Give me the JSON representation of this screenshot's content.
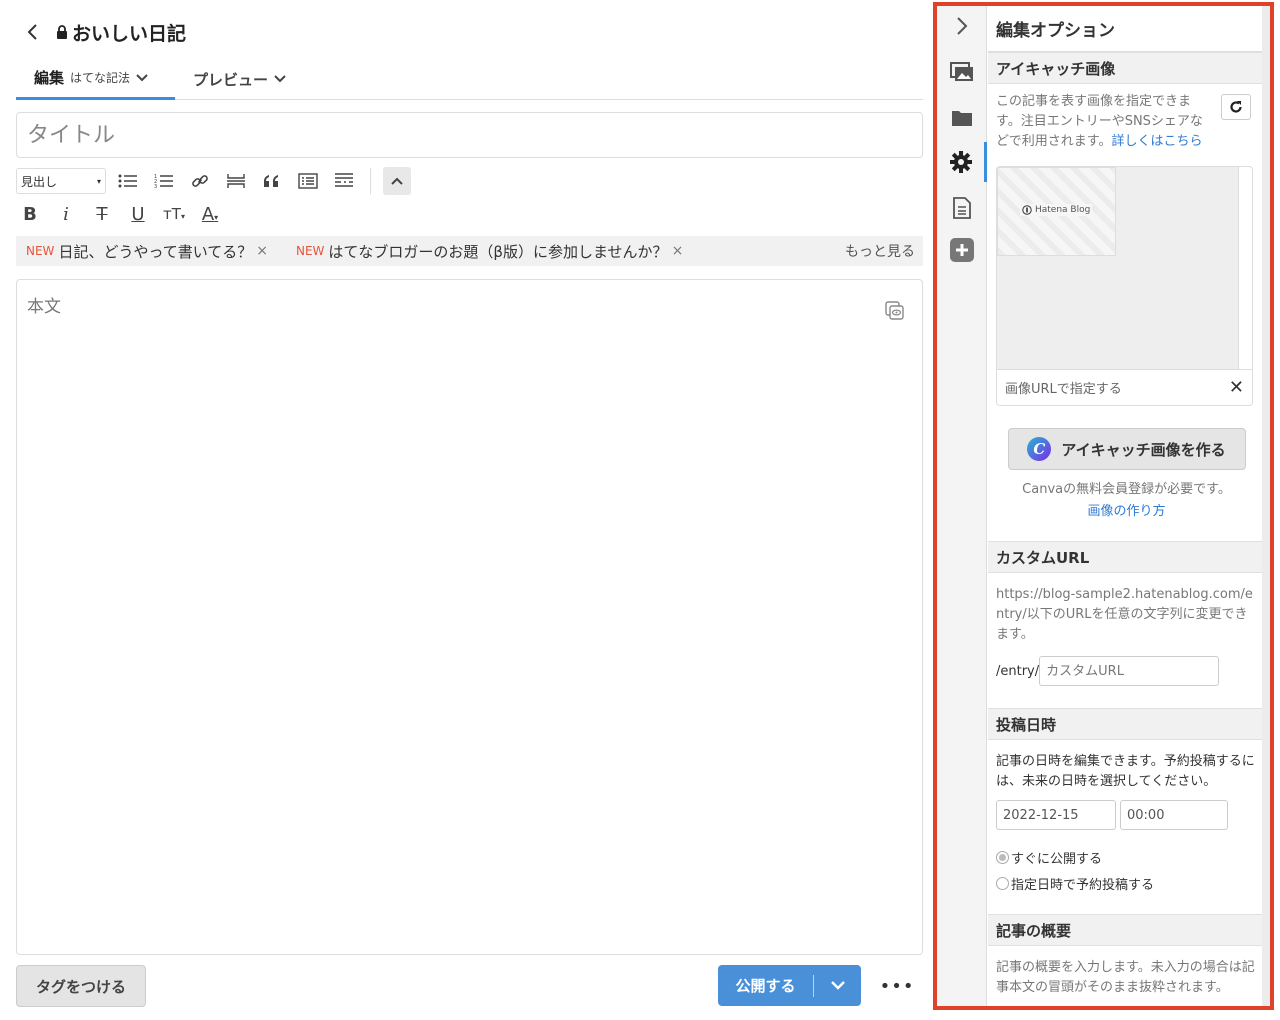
{
  "header": {
    "blog_title": "おいしい日記"
  },
  "tabs": {
    "edit_label": "編集",
    "edit_mode": "はてな記法",
    "preview_label": "プレビュー"
  },
  "editor": {
    "title_placeholder": "タイトル",
    "heading_select": "見出し",
    "body_placeholder": "本文"
  },
  "suggestions": {
    "items": [
      {
        "badge": "NEW",
        "text": "日記、どうやって書いてる？"
      },
      {
        "badge": "NEW",
        "text": "はてなブロガーのお題（β版）に参加しませんか？"
      }
    ],
    "more_label": "もっと見る"
  },
  "footer": {
    "tag_button": "タグをつける",
    "publish_button": "公開する",
    "more_label": "•••"
  },
  "panel": {
    "title": "編集オプション",
    "eyecatch": {
      "heading": "アイキャッチ画像",
      "description": "この記事を表す画像を指定できます。注目エントリーやSNSシェアなどで利用されます。",
      "details_link": "詳しくはこちら",
      "thumb_label": "Hatena Blog",
      "url_label": "画像URLで指定する",
      "canva_button": "アイキャッチ画像を作る",
      "canva_note": "Canvaの無料会員登録が必要です。",
      "howto_link": "画像の作り方"
    },
    "custom_url": {
      "heading": "カスタムURL",
      "description": "https://blog-sample2.hatenablog.com/entry/以下のURLを任意の文字列に変更できます。",
      "prefix": "/entry/",
      "placeholder": "カスタムURL"
    },
    "post_date": {
      "heading": "投稿日時",
      "description": "記事の日時を編集できます。予約投稿するには、未来の日時を選択してください。",
      "date_value": "2022-12-15",
      "time_value": "00:00",
      "option_now": "すぐに公開する",
      "option_scheduled": "指定日時で予約投稿する"
    },
    "summary": {
      "heading": "記事の概要",
      "description": "記事の概要を入力します。未入力の場合は記事本文の冒頭がそのまま抜粋されます。"
    }
  },
  "colors": {
    "accent": "#3a8fdc",
    "publish": "#4a90d9",
    "highlight_border": "#e0412a",
    "new_badge": "#e8533a"
  }
}
